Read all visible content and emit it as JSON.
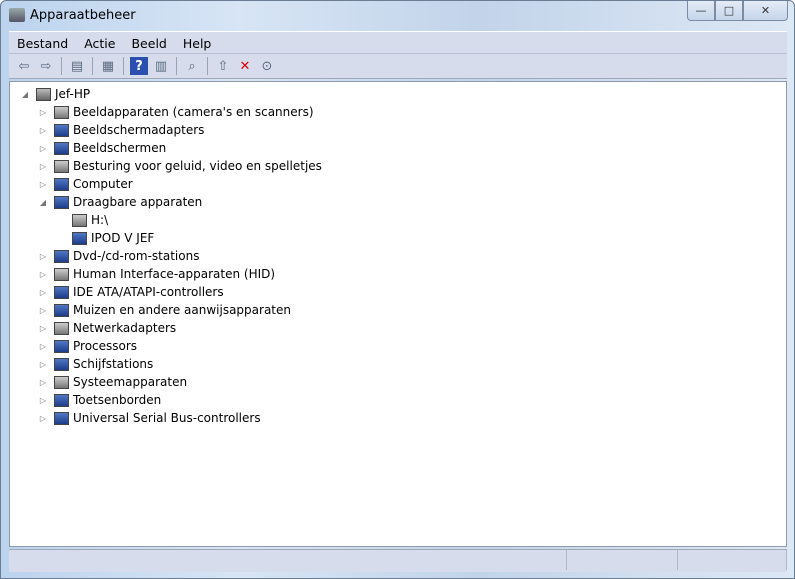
{
  "window": {
    "title": "Apparaatbeheer",
    "minimize": "—",
    "maximize": "□",
    "close": "✕"
  },
  "menu": [
    "Bestand",
    "Actie",
    "Beeld",
    "Help"
  ],
  "toolbar": [
    {
      "name": "back-icon",
      "glyph": "⇦"
    },
    {
      "name": "forward-icon",
      "glyph": "⇨"
    },
    {
      "sep": true
    },
    {
      "name": "show-hide-console-tree-icon",
      "glyph": "▤"
    },
    {
      "sep": true
    },
    {
      "name": "properties-icon",
      "glyph": "▦"
    },
    {
      "sep": true
    },
    {
      "name": "help-icon",
      "glyph": "?"
    },
    {
      "name": "show-action-pane-icon",
      "glyph": "▥"
    },
    {
      "sep": true
    },
    {
      "name": "scan-hardware-icon",
      "glyph": "⌕"
    },
    {
      "sep": true
    },
    {
      "name": "update-driver-icon",
      "glyph": "⇧"
    },
    {
      "name": "uninstall-icon",
      "glyph": "✕"
    },
    {
      "name": "disable-icon",
      "glyph": "⊙"
    }
  ],
  "tree": {
    "root": "Jef-HP",
    "items": [
      {
        "label": "Beeldapparaten (camera's en scanners)",
        "level": 1,
        "state": "collapsed"
      },
      {
        "label": "Beeldschermadapters",
        "level": 1,
        "state": "collapsed"
      },
      {
        "label": "Beeldschermen",
        "level": 1,
        "state": "collapsed"
      },
      {
        "label": "Besturing voor geluid, video en spelletjes",
        "level": 1,
        "state": "collapsed"
      },
      {
        "label": "Computer",
        "level": 1,
        "state": "collapsed"
      },
      {
        "label": "Draagbare apparaten",
        "level": 1,
        "state": "expanded"
      },
      {
        "label": "H:\\",
        "level": 2,
        "state": "leaf"
      },
      {
        "label": "IPOD V JEF",
        "level": 2,
        "state": "leaf"
      },
      {
        "label": "Dvd-/cd-rom-stations",
        "level": 1,
        "state": "collapsed"
      },
      {
        "label": "Human Interface-apparaten (HID)",
        "level": 1,
        "state": "collapsed"
      },
      {
        "label": "IDE ATA/ATAPI-controllers",
        "level": 1,
        "state": "collapsed"
      },
      {
        "label": "Muizen en andere aanwijsapparaten",
        "level": 1,
        "state": "collapsed"
      },
      {
        "label": "Netwerkadapters",
        "level": 1,
        "state": "collapsed"
      },
      {
        "label": "Processors",
        "level": 1,
        "state": "collapsed"
      },
      {
        "label": "Schijfstations",
        "level": 1,
        "state": "collapsed"
      },
      {
        "label": "Systeemapparaten",
        "level": 1,
        "state": "collapsed"
      },
      {
        "label": "Toetsenborden",
        "level": 1,
        "state": "collapsed"
      },
      {
        "label": "Universal Serial Bus-controllers",
        "level": 1,
        "state": "collapsed"
      }
    ]
  }
}
